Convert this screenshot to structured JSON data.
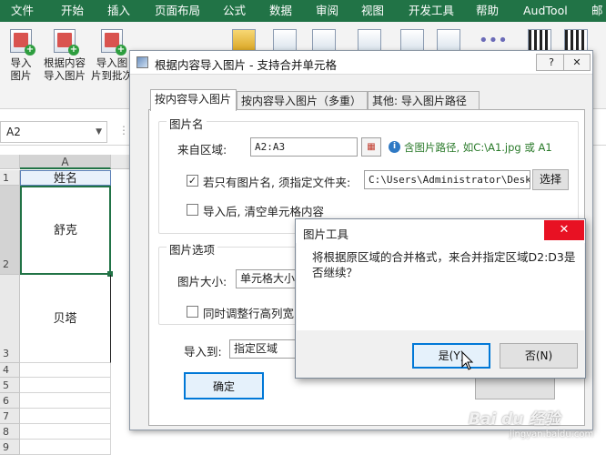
{
  "ribbon_tabs": [
    "文件",
    "开始",
    "插入",
    "页面布局",
    "公式",
    "数据",
    "审阅",
    "视图",
    "开发工具",
    "帮助",
    "AudTool",
    "邮"
  ],
  "ribbon_buttons": {
    "import_image": "导入\n图片",
    "import_by_content": "根据内容\n导入图片",
    "import_batch": "导入图\n片到批次"
  },
  "formula_bar": {
    "name_box": "A2",
    "sep": "⋮"
  },
  "sheet": {
    "col_header": "A",
    "rows": [
      "1",
      "2",
      "3",
      "4",
      "5",
      "6",
      "7",
      "8",
      "9"
    ],
    "cells": {
      "a1": "姓名",
      "a2": "舒克",
      "a3": "贝塔"
    }
  },
  "dialog": {
    "title": "根据内容导入图片 - 支持合并单元格",
    "help": "?",
    "close": "✕",
    "tabs": [
      "按内容导入图片",
      "按内容导入图片（多重）",
      "其他: 导入图片路径"
    ],
    "group_name": "图片名",
    "source_label": "来自区域:",
    "source_value": "A2:A3",
    "hint": "含图片路径, 如C:\\A1.jpg 或 A1",
    "only_name_label": "若只有图片名, 须指定文件夹:",
    "folder_value": "C:\\Users\\Administrator\\Desktop",
    "choose_btn": "选择",
    "clear_label": "导入后, 清空单元格内容",
    "group_options": "图片选项",
    "size_label": "图片大小:",
    "size_value": "单元格大小",
    "adjust_label": "同时调整行高列宽",
    "import_to_label": "导入到:",
    "import_to_value": "指定区域",
    "ok_btn": "确定"
  },
  "msgbox": {
    "title": "图片工具",
    "text": "将根据原区域的合并格式，来合并指定区域D2:D3是否继续？",
    "yes": "是(Y)",
    "no": "否(N)"
  },
  "watermark": {
    "brand": "Bai du 经验",
    "url": "jingyan.baidu.com"
  },
  "colors": {
    "excel_green": "#217346",
    "close_red": "#e81123",
    "accent_blue": "#0078d7"
  }
}
